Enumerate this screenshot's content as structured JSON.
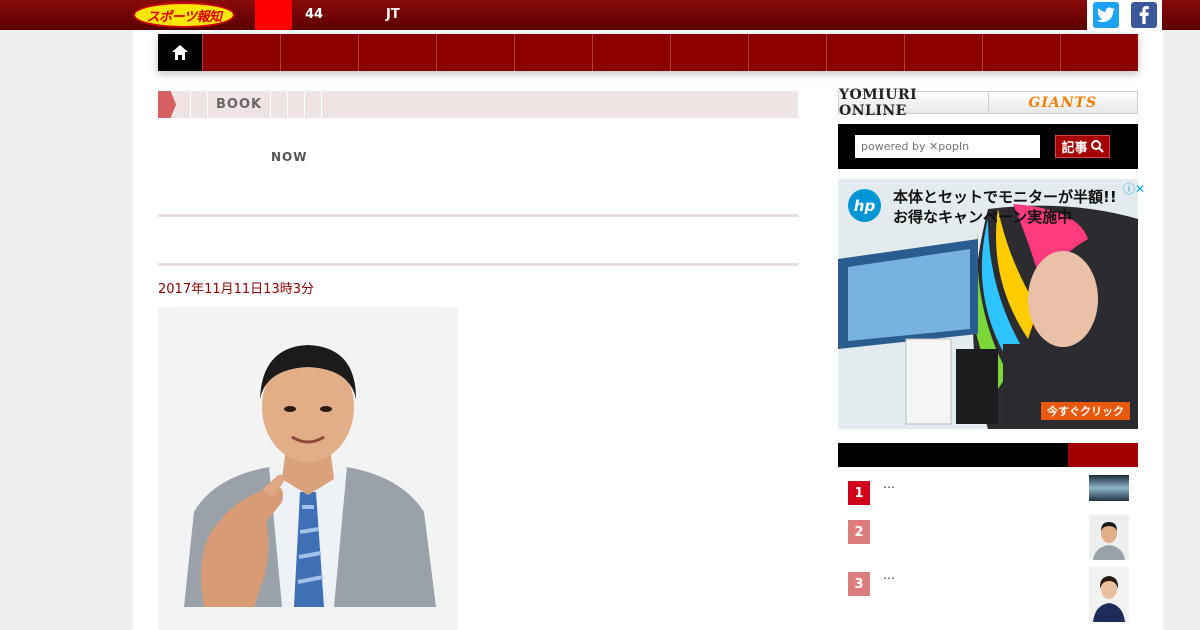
{
  "topbar": {
    "logo": "スポーツ報知",
    "ticker_1": "44",
    "ticker_2": "JT",
    "twitter_icon": "twitter-icon",
    "facebook_icon": "facebook-icon"
  },
  "nav": {
    "home_icon": "home-icon",
    "items": [
      "",
      "",
      "",
      "",
      "",
      "",
      "",
      "",
      "",
      "",
      "",
      ""
    ]
  },
  "breadcrumb": {
    "items": [
      "",
      "BOOK",
      "",
      "",
      ""
    ]
  },
  "subcategory": {
    "col1": "",
    "col2": "",
    "now": "NOW"
  },
  "article": {
    "headline": "",
    "date": "2017年11月11日13時3分",
    "source": "",
    "paragraphs": [
      "",
      "",
      ""
    ]
  },
  "sidebar": {
    "partners": [
      "YOMIURI ONLINE",
      "GIANTS"
    ],
    "search_placeholder": "powered by ✕popIn",
    "search_button": "記事",
    "ad": {
      "brand": "hp",
      "headline": "本体とセットでモニターが半額!!",
      "subline": "お得なキャンペーン実施中",
      "cta": "今すぐクリック",
      "info_icon": "adchoices-icon"
    },
    "ranking": {
      "header": "",
      "items": [
        {
          "rank": "1",
          "text": "…"
        },
        {
          "rank": "2",
          "text": ""
        },
        {
          "rank": "3",
          "text": "…"
        }
      ]
    }
  },
  "colors": {
    "brand_red": "#8c0000",
    "topbar_red": "#5a0000",
    "accent_red": "#d0001c",
    "logo_yellow": "#ffe600"
  }
}
